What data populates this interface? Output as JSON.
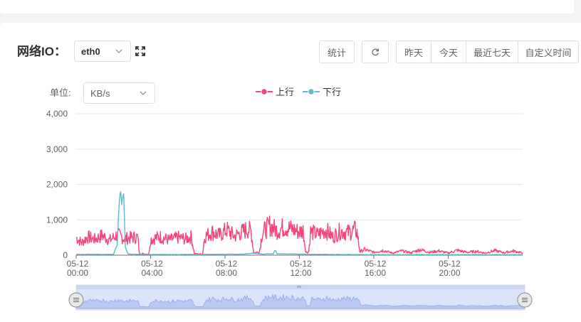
{
  "section": {
    "title": "网络IO：",
    "interface_value": "eth0",
    "unit_label": "单位:",
    "unit_value": "KB/s"
  },
  "toolbar": {
    "stats_label": "统计",
    "range_buttons": [
      {
        "label": "昨天",
        "active": true
      },
      {
        "label": "今天",
        "active": false
      },
      {
        "label": "最近七天",
        "active": false
      },
      {
        "label": "自定义时间",
        "active": false
      }
    ]
  },
  "colors": {
    "upload": "#f5467a",
    "download": "#5cb9cf",
    "active_button": "#20c048",
    "slider_fill": "#dbe4fb"
  },
  "icons": {
    "interface_chevron": "chevron-down-icon",
    "fullscreen": "fullscreen-icon",
    "refresh": "refresh-icon",
    "unit_chevron": "chevron-down-icon",
    "slider_handles": "slider-handle-icon"
  },
  "chart_data": {
    "type": "line",
    "legend_position": "top-center",
    "grid": true,
    "x_unit": "hours",
    "xlim": [
      0,
      24
    ],
    "ylim": [
      0,
      4000
    ],
    "yticks": [
      "4,000",
      "3,000",
      "2,000",
      "1,000",
      "0"
    ],
    "xticks": [
      {
        "date": "05-12",
        "time": "00:00",
        "x": 0
      },
      {
        "date": "05-12",
        "time": "04:00",
        "x": 4
      },
      {
        "date": "05-12",
        "time": "08:00",
        "x": 8
      },
      {
        "date": "05-12",
        "time": "12:00",
        "x": 12
      },
      {
        "date": "05-12",
        "time": "16:00",
        "x": 16
      },
      {
        "date": "05-12",
        "time": "20:00",
        "x": 20
      }
    ],
    "series": [
      {
        "name": "上行",
        "points": [
          [
            0,
            500
          ],
          [
            0.3,
            350
          ],
          [
            0.6,
            520
          ],
          [
            1.0,
            450
          ],
          [
            1.4,
            560
          ],
          [
            1.8,
            420
          ],
          [
            2.2,
            580
          ],
          [
            2.6,
            470
          ],
          [
            3.0,
            500
          ],
          [
            3.3,
            520
          ],
          [
            3.4,
            50
          ],
          [
            3.7,
            30
          ],
          [
            3.9,
            40
          ],
          [
            4.0,
            450
          ],
          [
            4.5,
            520
          ],
          [
            5.0,
            430
          ],
          [
            5.5,
            500
          ],
          [
            5.9,
            460
          ],
          [
            6.2,
            520
          ],
          [
            6.35,
            40
          ],
          [
            6.6,
            30
          ],
          [
            6.8,
            30
          ],
          [
            6.9,
            520
          ],
          [
            7.3,
            660
          ],
          [
            7.7,
            560
          ],
          [
            8.1,
            720
          ],
          [
            8.5,
            540
          ],
          [
            8.9,
            650
          ],
          [
            9.2,
            740
          ],
          [
            9.4,
            680
          ],
          [
            9.55,
            60
          ],
          [
            9.7,
            80
          ],
          [
            9.85,
            90
          ],
          [
            10.0,
            640
          ],
          [
            10.4,
            840
          ],
          [
            10.8,
            700
          ],
          [
            11.2,
            800
          ],
          [
            11.6,
            740
          ],
          [
            12.0,
            660
          ],
          [
            12.2,
            700
          ],
          [
            12.35,
            80
          ],
          [
            12.5,
            100
          ],
          [
            12.6,
            660
          ],
          [
            13.0,
            580
          ],
          [
            13.4,
            720
          ],
          [
            13.8,
            520
          ],
          [
            14.2,
            680
          ],
          [
            14.6,
            640
          ],
          [
            15.0,
            720
          ],
          [
            15.1,
            650
          ],
          [
            15.25,
            100
          ],
          [
            15.5,
            160
          ],
          [
            16.0,
            80
          ],
          [
            16.5,
            140
          ],
          [
            17.0,
            60
          ],
          [
            17.5,
            120
          ],
          [
            18.0,
            70
          ],
          [
            18.5,
            160
          ],
          [
            19.0,
            80
          ],
          [
            19.5,
            120
          ],
          [
            20.0,
            60
          ],
          [
            20.5,
            140
          ],
          [
            21.0,
            80
          ],
          [
            21.5,
            110
          ],
          [
            22.0,
            60
          ],
          [
            22.5,
            130
          ],
          [
            23.0,
            70
          ],
          [
            23.5,
            120
          ],
          [
            24.0,
            60
          ]
        ]
      },
      {
        "name": "下行",
        "points": [
          [
            0,
            20
          ],
          [
            1.0,
            25
          ],
          [
            2.0,
            20
          ],
          [
            2.2,
            300
          ],
          [
            2.35,
            1750
          ],
          [
            2.45,
            1500
          ],
          [
            2.55,
            1600
          ],
          [
            2.65,
            200
          ],
          [
            2.8,
            30
          ],
          [
            4.0,
            20
          ],
          [
            6.0,
            20
          ],
          [
            8.0,
            25
          ],
          [
            9.0,
            30
          ],
          [
            9.5,
            60
          ],
          [
            10.0,
            30
          ],
          [
            10.6,
            40
          ],
          [
            10.7,
            150
          ],
          [
            10.8,
            40
          ],
          [
            12.0,
            30
          ],
          [
            14.0,
            20
          ],
          [
            16.0,
            15
          ],
          [
            20.0,
            15
          ],
          [
            24.0,
            15
          ]
        ]
      }
    ]
  }
}
